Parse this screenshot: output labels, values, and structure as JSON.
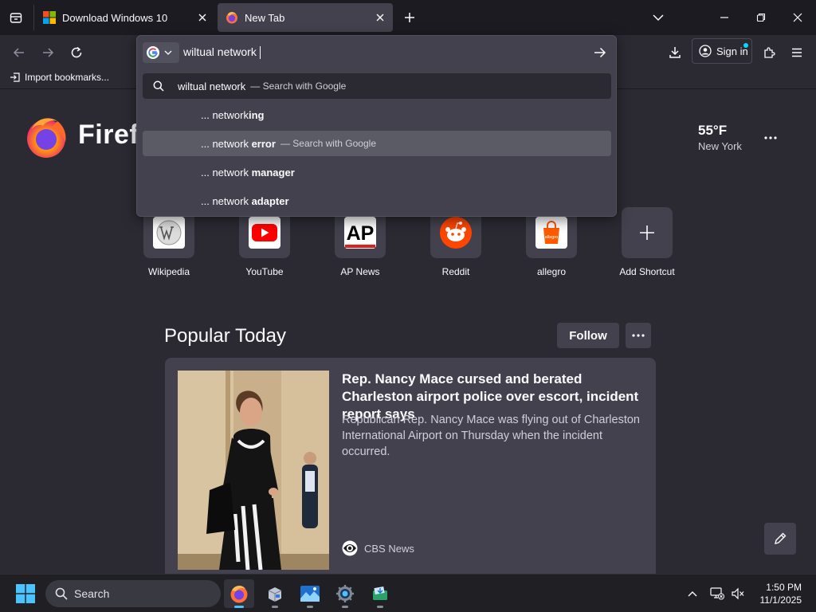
{
  "tabs": [
    {
      "title": "Download Windows 10",
      "favicon": "windows-logo-icon",
      "active": false
    },
    {
      "title": "New Tab",
      "favicon": "firefox-icon",
      "active": true
    }
  ],
  "urlbar": {
    "value": "wiltual network",
    "search_engine": "Google",
    "suggestions": [
      {
        "prefix": "wiltual network",
        "bold": "",
        "hint": "— Search with Google"
      },
      {
        "prefix": "... network",
        "bold": "ing",
        "hint": ""
      },
      {
        "prefix": "... network ",
        "bold": "error",
        "hint": "— Search with Google"
      },
      {
        "prefix": "... network ",
        "bold": "manager",
        "hint": ""
      },
      {
        "prefix": "... network ",
        "bold": "adapter",
        "hint": ""
      }
    ]
  },
  "toolbar": {
    "signin_label": "Sign in"
  },
  "bookmarks": {
    "import_label": "Import bookmarks..."
  },
  "newtab": {
    "wordmark": "Firefox",
    "weather": {
      "temp": "55°F",
      "city": "New York"
    },
    "shortcuts": [
      {
        "label": "Wikipedia",
        "icon": "wikipedia-icon"
      },
      {
        "label": "YouTube",
        "icon": "youtube-icon"
      },
      {
        "label": "AP News",
        "icon": "ap-news-icon"
      },
      {
        "label": "Reddit",
        "icon": "reddit-icon"
      },
      {
        "label": "allegro",
        "icon": "allegro-icon"
      },
      {
        "label": "Add Shortcut",
        "icon": "plus-icon"
      }
    ],
    "popular": {
      "title": "Popular Today",
      "follow_label": "Follow",
      "story": {
        "title": "Rep. Nancy Mace cursed and berated Charleston airport police over escort, incident report says",
        "description": "Republican Rep. Nancy Mace was flying out of Charleston International Airport on Thursday when the incident occurred.",
        "source": "CBS News"
      }
    }
  },
  "taskbar": {
    "search_placeholder": "Search",
    "time": "1:50 PM",
    "date": "11/1/2025"
  },
  "colors": {
    "background": "#2b2a33",
    "toolbar": "#1c1b22",
    "surface": "#42414d",
    "accent": "#00ddff",
    "taskbar": "#1f1f24"
  }
}
